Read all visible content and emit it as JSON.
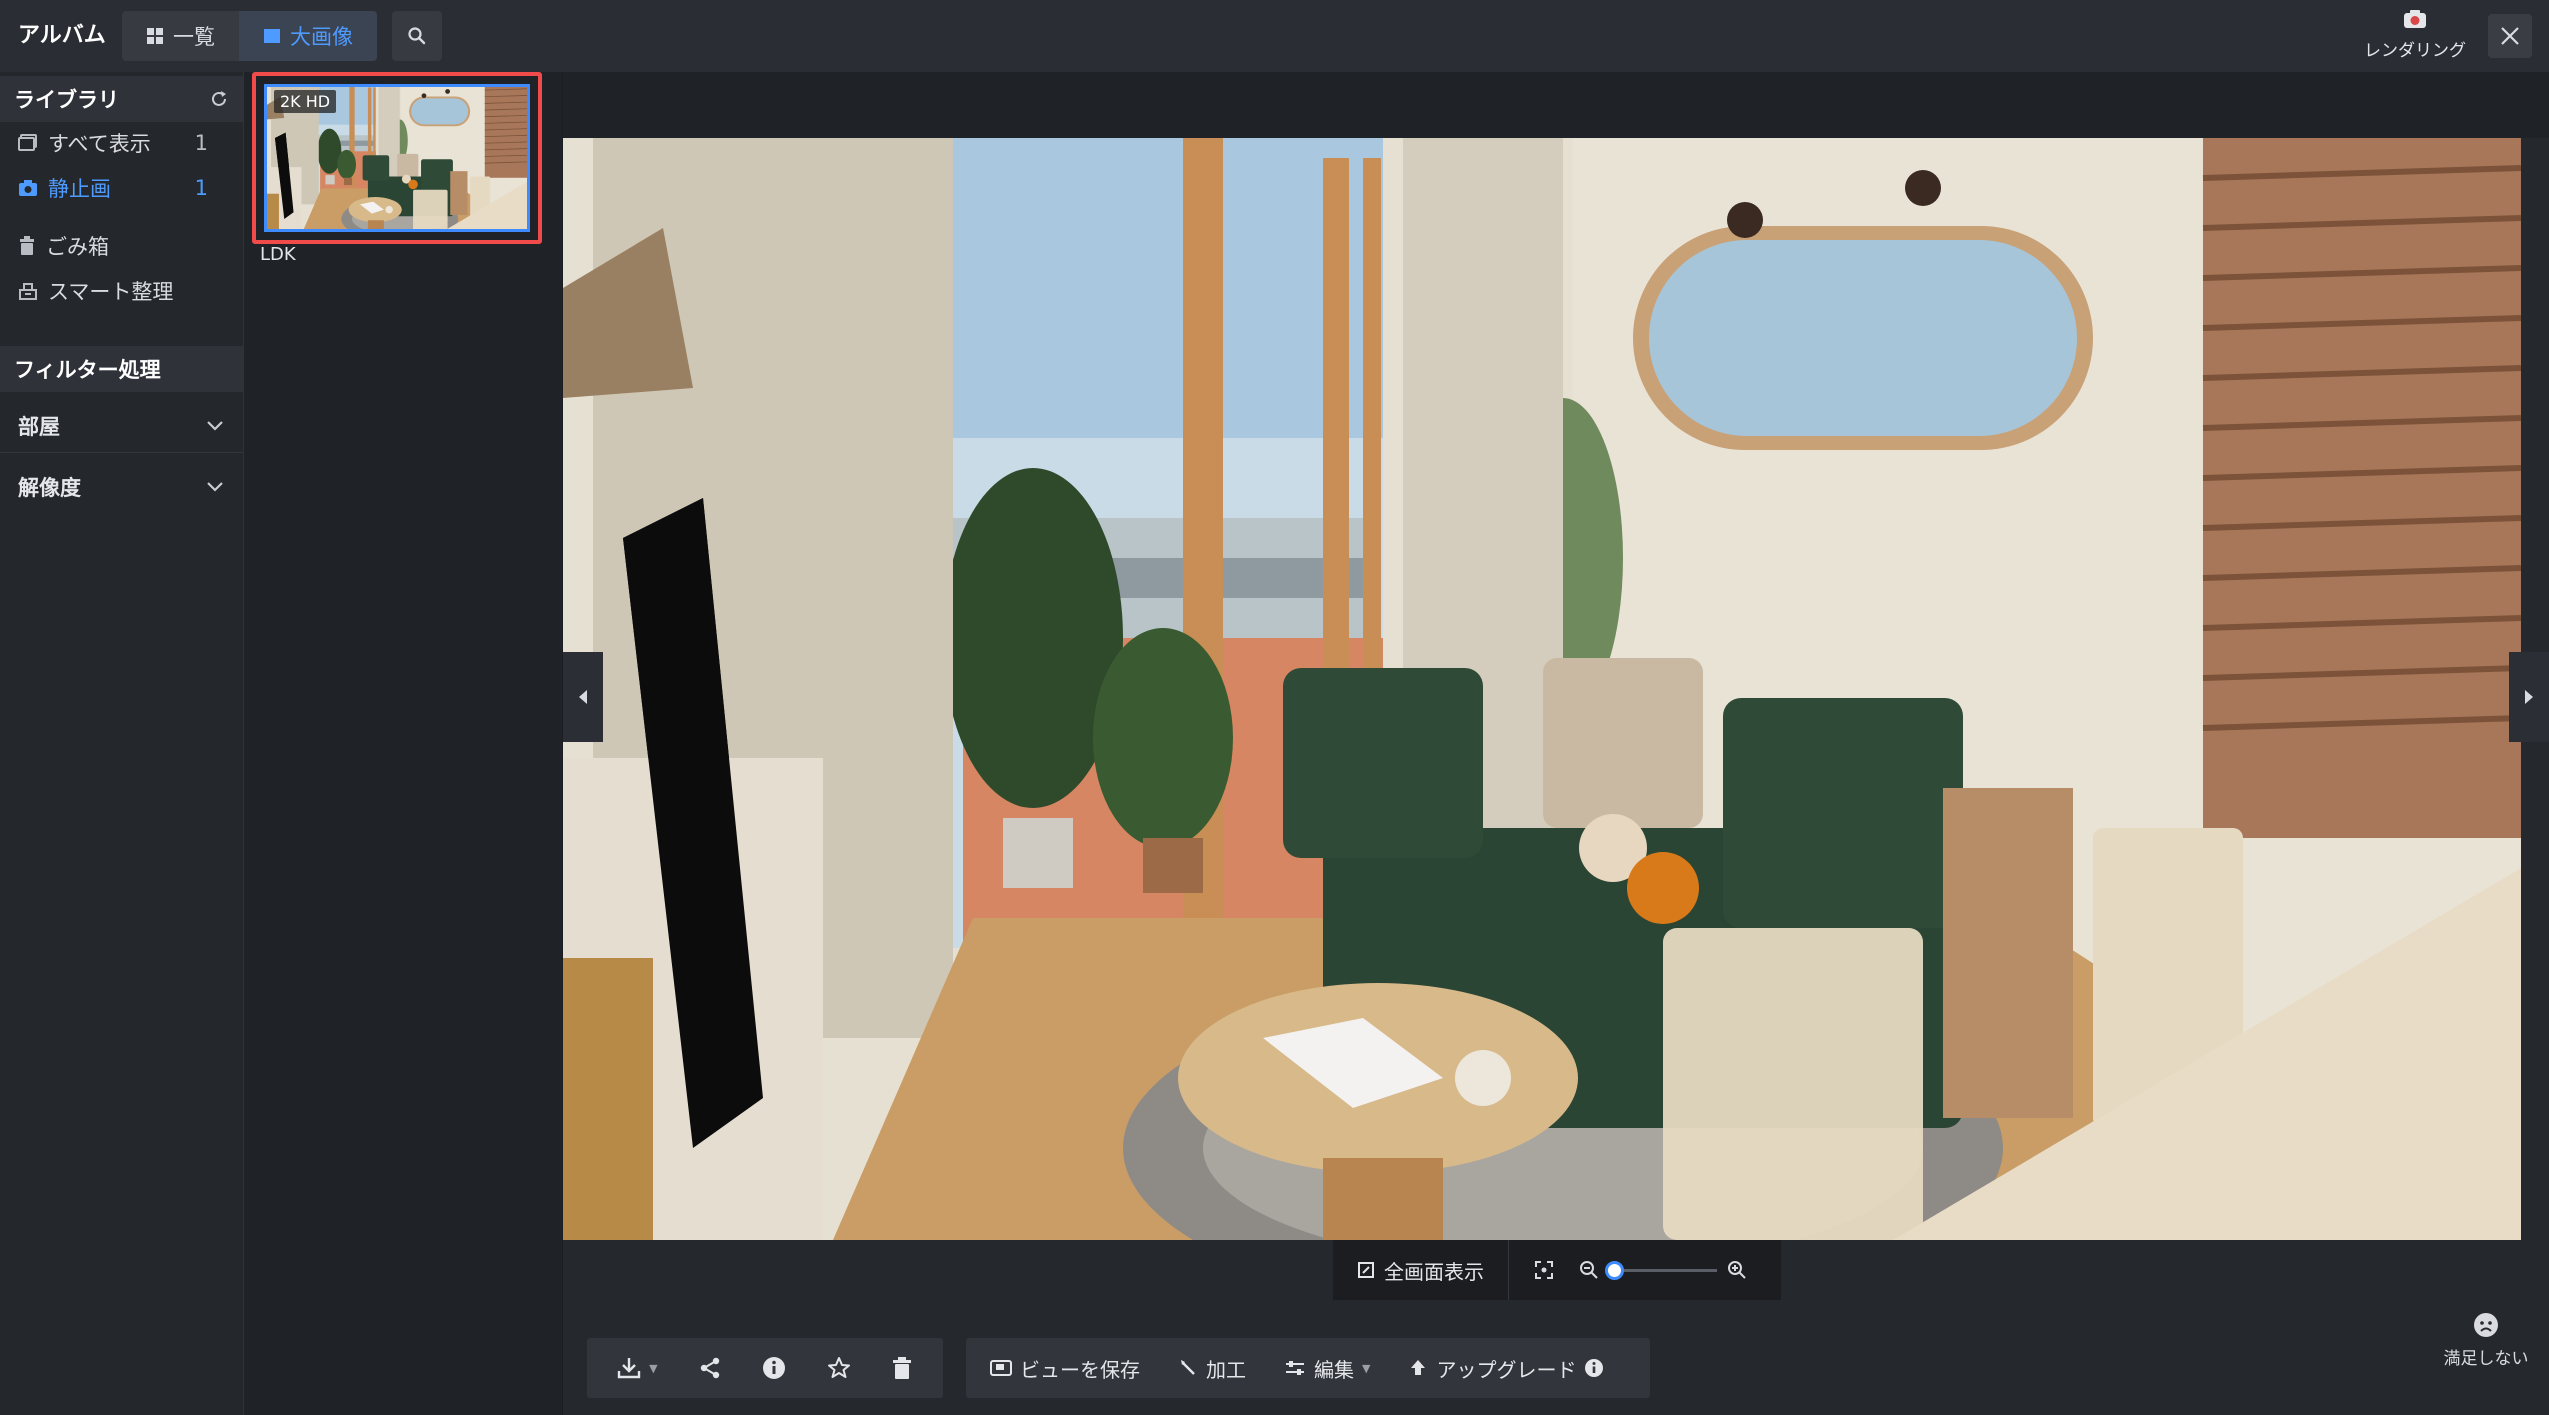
{
  "app": {
    "title": "アルバム"
  },
  "view_toggle": {
    "list_label": "一覧",
    "large_label": "大画像",
    "active": "large"
  },
  "header": {
    "render_label": "レンダリング"
  },
  "sidebar": {
    "library": {
      "title": "ライブラリ"
    },
    "items": [
      {
        "label": "すべて表示",
        "count": "1",
        "icon": "album-icon"
      },
      {
        "label": "静止画",
        "count": "1",
        "icon": "camera-icon",
        "active": true
      },
      {
        "label": "ごみ箱",
        "icon": "trash-icon"
      },
      {
        "label": "スマート整理",
        "icon": "organize-icon"
      }
    ],
    "filter": {
      "title": "フィルター処理"
    },
    "filters": [
      {
        "label": "部屋"
      },
      {
        "label": "解像度"
      }
    ]
  },
  "thumbnail": {
    "badge": "2K HD",
    "label": "LDK"
  },
  "viewer": {
    "fullscreen_label": "全画面表示",
    "zoom_level": 0
  },
  "toolbar": {
    "left_icons": [
      "download-icon",
      "share-icon",
      "info-icon",
      "star-icon",
      "trash-icon"
    ],
    "save_view_label": "ビューを保存",
    "process_label": "加工",
    "edit_label": "編集",
    "upgrade_label": "アップグレード"
  },
  "feedback": {
    "label": "満足しない"
  },
  "colors": {
    "accent": "#3d8bff",
    "highlight_border": "#f04a4a",
    "background": "#1b1d22"
  }
}
